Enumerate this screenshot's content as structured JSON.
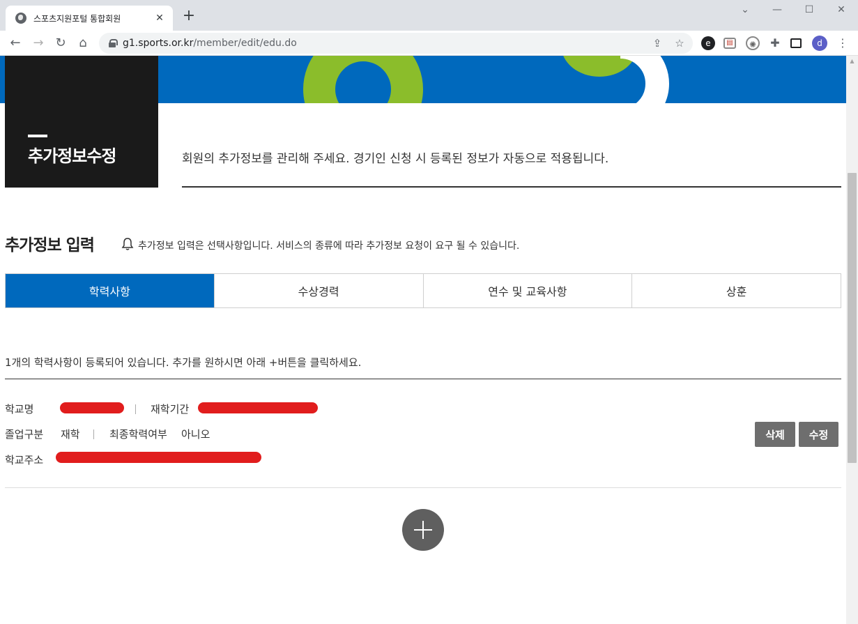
{
  "browser": {
    "tab_title": "스포츠지원포털 통합회원",
    "tab_close": "✕",
    "new_tab": "+",
    "url_host": "g1.sports.or.kr",
    "url_path": "/member/edit/edu.do",
    "profile_initial": "d",
    "window_controls": {
      "minimize": "—",
      "maximize": "☐",
      "close": "✕",
      "dropdown": "⌄"
    },
    "nav": {
      "back": "←",
      "forward": "→",
      "reload": "↻",
      "home": "⌂"
    },
    "icons": [
      "share-icon",
      "star-icon",
      "extension-e-icon",
      "extension-cast-icon",
      "extension-round-icon",
      "puzzle-icon",
      "sidebar-icon",
      "menu-icon"
    ]
  },
  "header": {
    "title": "추가정보수정",
    "intro": "회원의 추가정보를 관리해 주세요. 경기인 신청 시 등록된 정보가 자동으로 적용됩니다."
  },
  "section": {
    "title": "추가정보 입력",
    "note": "추가정보 입력은 선택사항입니다. 서비스의 종류에 따라 추가정보 요청이 요구 될 수 있습니다."
  },
  "tabs": [
    {
      "label": "학력사항",
      "active": true
    },
    {
      "label": "수상경력",
      "active": false
    },
    {
      "label": "연수 및 교육사항",
      "active": false
    },
    {
      "label": "상훈",
      "active": false
    }
  ],
  "list": {
    "count_message": "1개의 학력사항이 등록되어 있습니다. 추가를 원하시면 아래 +버튼을 클릭하세요.",
    "record": {
      "school_label": "학교명",
      "period_label": "재학기간",
      "graduation_label": "졸업구분",
      "graduation_value": "재학",
      "final_label": "최종학력여부",
      "final_value": "아니오",
      "address_label": "학교주소",
      "delete_button": "삭제",
      "edit_button": "수정"
    }
  },
  "colors": {
    "brand_blue": "#0069bd",
    "brand_green": "#8bbd2b",
    "title_box": "#1a1a1a",
    "button_gray": "#6e6e6e",
    "redaction": "#e11d1d"
  }
}
